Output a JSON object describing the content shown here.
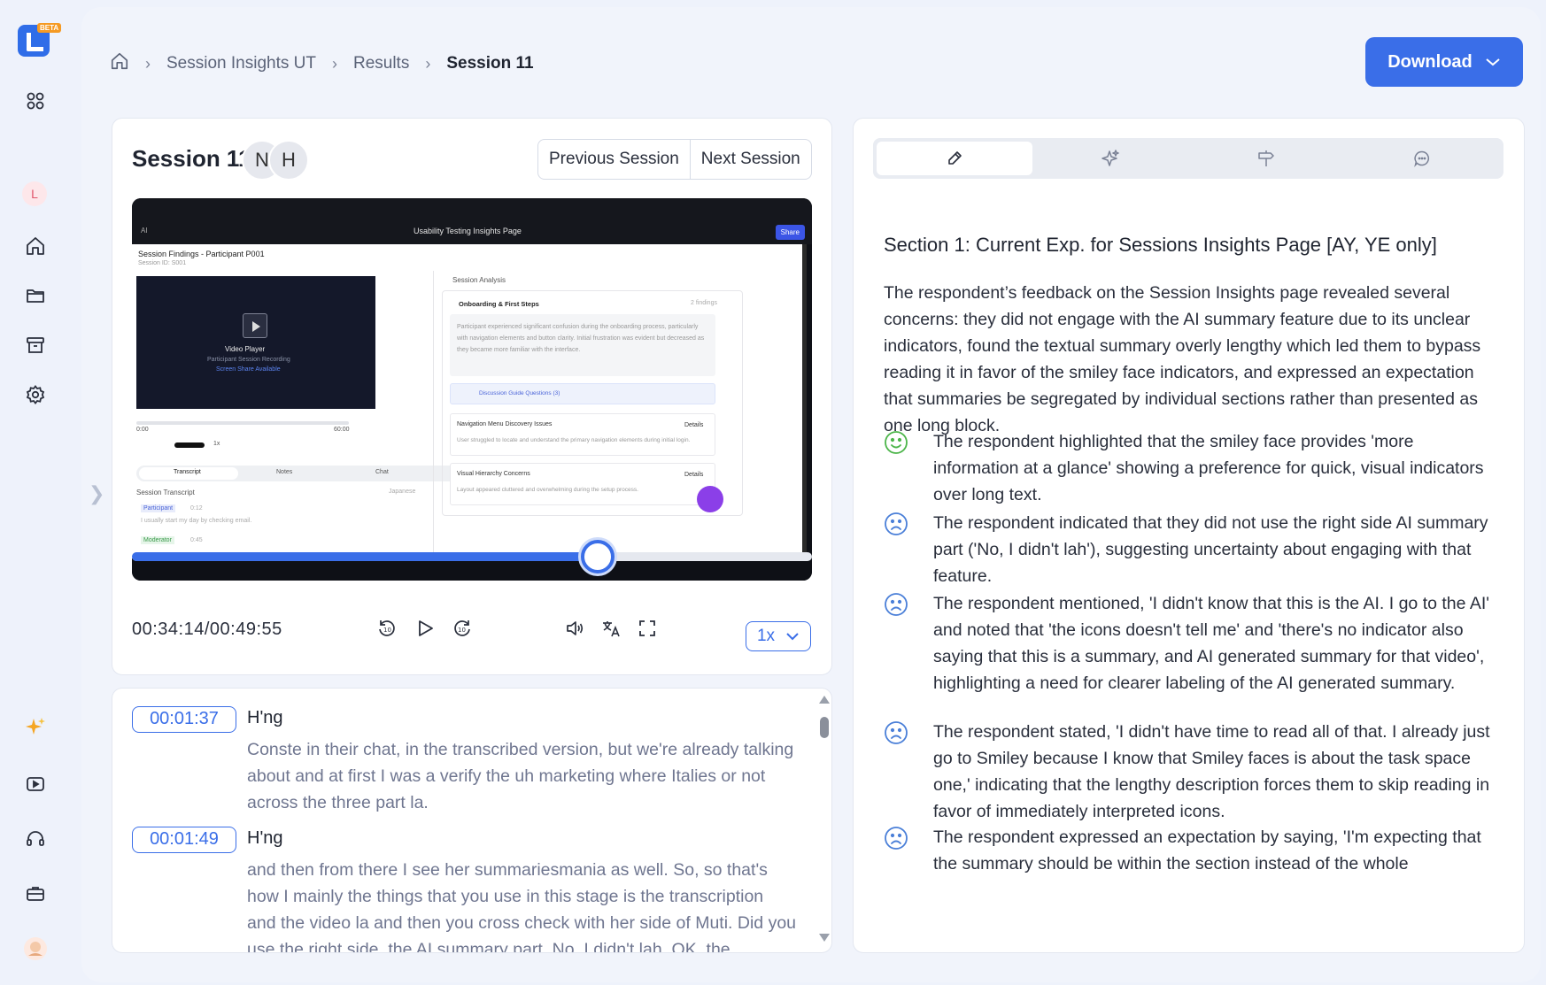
{
  "app": {
    "badge": "BETA",
    "user_initial": "L"
  },
  "breadcrumb": {
    "items": [
      "Session Insights UT",
      "Results"
    ],
    "current": "Session 11"
  },
  "download": {
    "label": "Download"
  },
  "session": {
    "title": "Session 11",
    "participants": [
      "N",
      "H"
    ],
    "prev_label": "Previous Session",
    "next_label": "Next Session"
  },
  "video": {
    "inner": {
      "app_label": "AI",
      "page_title": "Usability Testing Insights Page",
      "share_label": "Share",
      "findings_title": "Session Findings - Participant P001",
      "session_id": "Session ID: S001",
      "player_title": "Video Player",
      "player_sub": "Participant Session Recording",
      "player_link": "Screen Share Available",
      "time_start": "0:00",
      "time_end": "60:00",
      "speed": "1x",
      "tabs": [
        "Transcript",
        "Notes",
        "Chat"
      ],
      "transcript_title": "Session Transcript",
      "language": "Japanese",
      "participant_tag": "Participant",
      "participant_time": "0:12",
      "participant_text": "I usually start my day by checking email.",
      "moderator_tag": "Moderator",
      "moderator_time": "0:45",
      "analysis_title": "Session Analysis",
      "section_title": "Onboarding & First Steps",
      "section_count": "2 findings",
      "section_text": "Participant experienced significant confusion during the onboarding process, particularly with navigation elements and button clarity. Initial frustration was evident but decreased as they became more familiar with the interface.",
      "guide_label": "Discussion Guide Questions (3)",
      "card1_title": "Navigation Menu Discovery Issues",
      "card1_text": "User struggled to locate and understand the primary navigation elements during initial login.",
      "card2_title": "Visual Hierarchy Concerns",
      "card2_text": "Layout appeared cluttered and overwhelming during the setup process.",
      "details_label": "Details"
    },
    "current_time": "00:34:14",
    "total_time": "00:49:55",
    "progress": 0.685,
    "speed": "1x"
  },
  "transcript": [
    {
      "time": "00:01:37",
      "speaker": "H'ng",
      "text": "Conste in their chat, in the transcribed version, but we're already talking about and at first I was a verify the uh marketing where Italies or not across the three part la."
    },
    {
      "time": "00:01:49",
      "speaker": "H'ng",
      "text": "and then from there I see her summariesmania as well. So, so that's how I mainly the things that you use in this stage is the transcription and the video la and then you cross check with her side of Muti. Did you use the right side, the AI summary part. No, I didn't lah. OK, the"
    }
  ],
  "insights": {
    "tabs": [
      "edit-icon",
      "sparkle-icon",
      "signpost-icon",
      "chat-icon"
    ],
    "section_title": "Section 1: Current Exp. for Sessions Insights Page [AY, YE only]",
    "summary": "The respondent’s feedback on the Session Insights page revealed several concerns: they did not engage with the AI summary feature due to its unclear indicators, found the textual summary overly lengthy which led them to bypass reading it in favor of the smiley face indicators, and expressed an expectation that summaries be segregated by individual sections rather than presented as one long block.",
    "findings": [
      {
        "sentiment": "positive",
        "color": "#4cb54a",
        "text": "The respondent highlighted that the smiley face provides 'more information at a glance' showing a preference for quick, visual indicators over long text."
      },
      {
        "sentiment": "negative",
        "color": "#4a7fd8",
        "text": "The respondent indicated that they did not use the right side AI summary part ('No, I didn't lah'), suggesting uncertainty about engaging with that feature."
      },
      {
        "sentiment": "negative",
        "color": "#4a7fd8",
        "text": "The respondent mentioned, 'I didn't know that this is the AI. I go to the AI' and noted that 'the icons doesn't tell me' and 'there's no indicator also saying that this is a summary, and AI generated summary for that video', highlighting a need for clearer labeling of the AI generated summary."
      },
      {
        "sentiment": "negative",
        "color": "#4a7fd8",
        "text": "The respondent stated, 'I didn't have time to read all of that. I already just go to Smiley because I know that Smiley faces is about the task space one,' indicating that the lengthy description forces them to skip reading in favor of immediately interpreted icons."
      },
      {
        "sentiment": "negative",
        "color": "#4a7fd8",
        "text": "The respondent expressed an expectation by saying, 'I'm expecting that the summary should be within the section instead of the whole"
      }
    ]
  },
  "colors": {
    "accent": "#3a6ee8",
    "positive": "#4cb54a",
    "negative": "#4a7fd8"
  }
}
